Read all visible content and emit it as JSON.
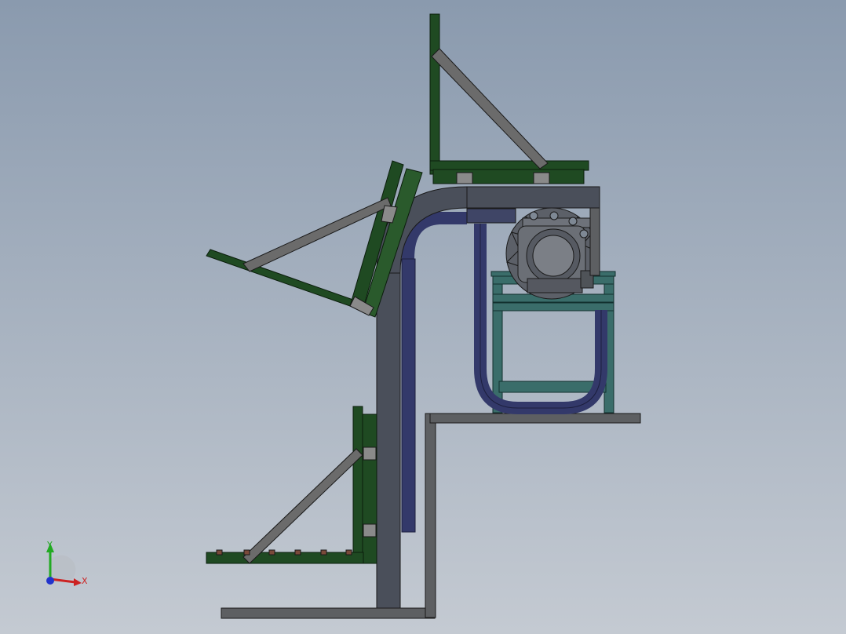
{
  "viewport": {
    "background_top": "#8a9aae",
    "background_bottom": "#c4cad2"
  },
  "model": {
    "frame_color": "#1f4a22",
    "tube_color": "#4a4f5a",
    "chain_color": "#33396a",
    "bracket_color": "#6b6b6b",
    "stand_color": "#3a6d6a"
  },
  "triad": {
    "x_label": "X",
    "y_label": "Y",
    "x_color": "#cc2222",
    "y_color": "#22aa22",
    "z_color": "#2233cc"
  }
}
